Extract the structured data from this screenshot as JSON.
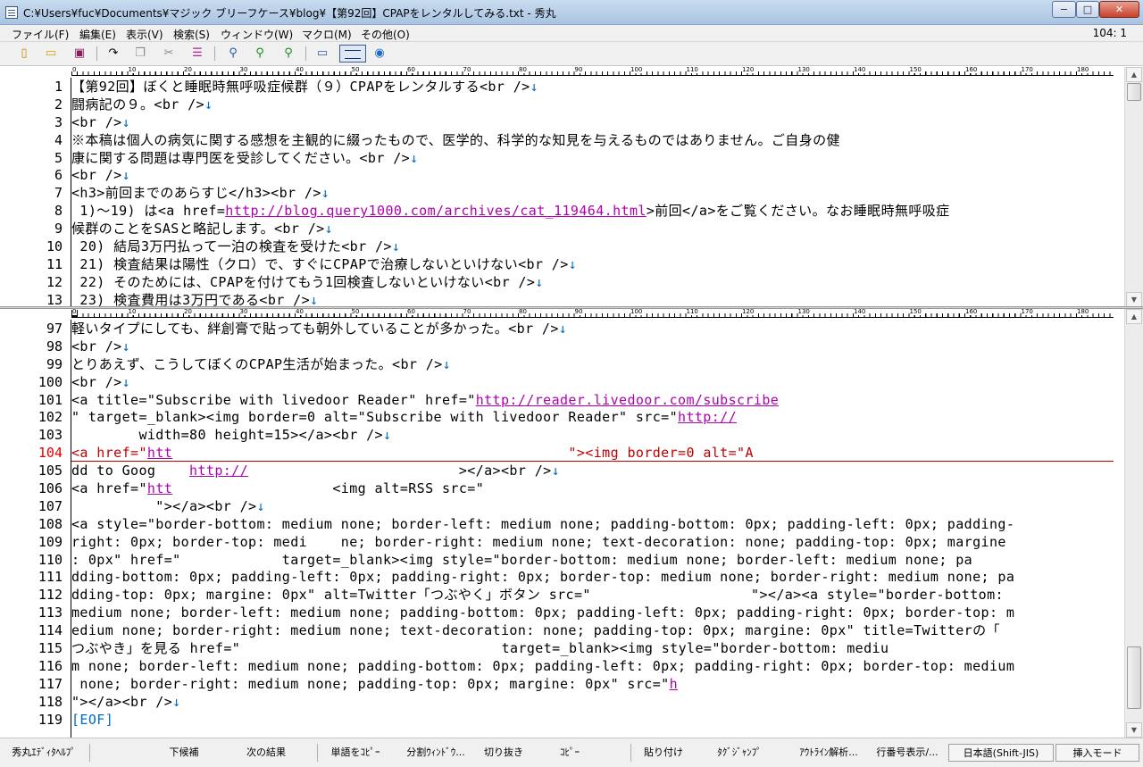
{
  "window": {
    "title": "C:¥Users¥fuc¥Documents¥マジック ブリーフケース¥blog¥【第92回】CPAPをレンタルしてみる.txt - 秀丸",
    "min": "−",
    "max": "□",
    "close": "✕"
  },
  "menu": {
    "items": [
      "ファイル(F)",
      "編集(E)",
      "表示(V)",
      "検索(S)",
      "ウィンドウ(W)",
      "マクロ(M)",
      "その他(O)"
    ],
    "cursor_position": "104: 1"
  },
  "toolbar": {
    "icons": [
      "new-file-icon",
      "open-folder-icon",
      "save-icon",
      "undo-icon",
      "copy-icon",
      "cut-icon",
      "paste-icon",
      "search-icon",
      "search-down-icon",
      "search-up-icon",
      "window-icon",
      "split-window-icon",
      "globe-icon"
    ]
  },
  "ruler": {
    "labels": [
      "0",
      "10",
      "20",
      "30",
      "40",
      "50",
      "60",
      "70",
      "80",
      "90",
      "100",
      "110",
      "120",
      "130",
      "140",
      "150",
      "160",
      "170",
      "180"
    ]
  },
  "editor_top": {
    "lines": [
      {
        "n": "1",
        "parts": [
          {
            "t": "【第92回】ぼくと睡眠時無呼吸症候群（９）CPAPをレンタルする<br />"
          }
        ]
      },
      {
        "n": "2",
        "parts": [
          {
            "t": "闘病記の９。<br />"
          }
        ]
      },
      {
        "n": "3",
        "parts": [
          {
            "t": "<br />"
          }
        ]
      },
      {
        "n": "4",
        "parts": [
          {
            "t": "※本稿は個人の病気に関する感想を主観的に綴ったもので、医学的、科学的な知見を与えるものではありません。ご自身の健"
          }
        ],
        "wrap": true
      },
      {
        "n": "5",
        "parts": [
          {
            "t": "康に関する問題は専門医を受診してください。<br />"
          }
        ]
      },
      {
        "n": "6",
        "parts": [
          {
            "t": "<br />"
          }
        ]
      },
      {
        "n": "7",
        "parts": [
          {
            "t": "<h3>前回までのあらすじ</h3><br />"
          }
        ]
      },
      {
        "n": "8",
        "parts": [
          {
            "t": " 1)〜19) は<a href="
          },
          {
            "t": "http://blog.query1000.com/archives/cat_119464.html",
            "url": true
          },
          {
            "t": ">前回</a>をご覧ください。なお睡眠時無呼吸症"
          }
        ],
        "wrap": true
      },
      {
        "n": "9",
        "parts": [
          {
            "t": "候群のことをSASと略記します。<br />"
          }
        ]
      },
      {
        "n": "10",
        "parts": [
          {
            "t": " 20) 結局3万円払って一泊の検査を受けた<br />"
          }
        ]
      },
      {
        "n": "11",
        "parts": [
          {
            "t": " 21) 検査結果は陽性（クロ）で、すぐにCPAPで治療しないといけない<br />"
          }
        ]
      },
      {
        "n": "12",
        "parts": [
          {
            "t": " 22) そのためには、CPAPを付けてもう1回検査しないといけない<br />"
          }
        ]
      },
      {
        "n": "13",
        "parts": [
          {
            "t": " 23) 検査費用は3万円である<br />"
          }
        ]
      }
    ]
  },
  "editor_bottom": {
    "current_line": "104",
    "lines": [
      {
        "n": "97",
        "parts": [
          {
            "t": "軽いタイプにしても、絆創膏で貼っても朝外していることが多かった。<br />"
          }
        ]
      },
      {
        "n": "98",
        "parts": [
          {
            "t": "<br />"
          }
        ]
      },
      {
        "n": "99",
        "parts": [
          {
            "t": "とりあえず、こうしてぼくのCPAP生活が始まった。<br />"
          }
        ]
      },
      {
        "n": "100",
        "parts": [
          {
            "t": "<br />"
          }
        ]
      },
      {
        "n": "101",
        "parts": [
          {
            "t": "<a title=\"Subscribe with livedoor Reader\" href=\""
          },
          {
            "t": "http://reader.livedoor.com/subscribe",
            "url": true
          }
        ],
        "wrap": true
      },
      {
        "n": "102",
        "parts": [
          {
            "t": "\" target=_blank><img border=0 alt=\"Subscribe with livedoor Reader\" src=\""
          },
          {
            "t": "http://",
            "url": true
          }
        ],
        "wrap": true
      },
      {
        "n": "103",
        "parts": [
          {
            "t": "        width=80 height=15></a><br />"
          }
        ]
      },
      {
        "n": "104",
        "parts": [
          {
            "t": "<a href=\""
          },
          {
            "t": "htt",
            "url": true
          },
          {
            "t": "                                               \"><img border=0 alt=\"A"
          }
        ],
        "wrap": true
      },
      {
        "n": "105",
        "parts": [
          {
            "t": "dd to Goog    "
          },
          {
            "t": "http://",
            "url": true
          },
          {
            "t": "                         ></a><br />"
          }
        ]
      },
      {
        "n": "106",
        "parts": [
          {
            "t": "<a href=\""
          },
          {
            "t": "htt",
            "url": true
          },
          {
            "t": "                   <img alt=RSS src=\""
          }
        ],
        "wrap": true
      },
      {
        "n": "107",
        "parts": [
          {
            "t": "          \"></a><br />"
          }
        ]
      },
      {
        "n": "108",
        "parts": [
          {
            "t": "<a style=\"border-bottom: medium none; border-left: medium none; padding-bottom: 0px; padding-left: 0px; padding-"
          }
        ],
        "wrap": true
      },
      {
        "n": "109",
        "parts": [
          {
            "t": "right: 0px; border-top: medi    ne; border-right: medium none; text-decoration: none; padding-top: 0px; margine"
          }
        ],
        "wrap": true
      },
      {
        "n": "110",
        "parts": [
          {
            "t": ": 0px\" href=\"            target=_blank><img style=\"border-bottom: medium none; border-left: medium none; pa"
          }
        ],
        "wrap": true
      },
      {
        "n": "111",
        "parts": [
          {
            "t": "dding-bottom: 0px; padding-left: 0px; padding-right: 0px; border-top: medium none; border-right: medium none; pa"
          }
        ],
        "wrap": true
      },
      {
        "n": "112",
        "parts": [
          {
            "t": "dding-top: 0px; margine: 0px\" alt=Twitter「つぶやく」ボタン src=\"                   \"></a><a style=\"border-bottom:"
          }
        ],
        "wrap": true
      },
      {
        "n": "113",
        "parts": [
          {
            "t": "medium none; border-left: medium none; padding-bottom: 0px; padding-left: 0px; padding-right: 0px; border-top: m"
          }
        ],
        "wrap": true
      },
      {
        "n": "114",
        "parts": [
          {
            "t": "edium none; border-right: medium none; text-decoration: none; padding-top: 0px; margine: 0px\" title=Twitterの「"
          }
        ],
        "wrap": true
      },
      {
        "n": "115",
        "parts": [
          {
            "t": "つぶやき」を見る href=\"                               target=_blank><img style=\"border-bottom: mediu"
          }
        ],
        "wrap": true
      },
      {
        "n": "116",
        "parts": [
          {
            "t": "m none; border-left: medium none; padding-bottom: 0px; padding-left: 0px; padding-right: 0px; border-top: medium"
          }
        ],
        "wrap": true
      },
      {
        "n": "117",
        "parts": [
          {
            "t": " none; border-right: medium none; padding-top: 0px; margine: 0px\" src=\""
          },
          {
            "t": "h",
            "url": true
          }
        ],
        "wrap": true
      },
      {
        "n": "118",
        "parts": [
          {
            "t": "\"></a><br />"
          }
        ]
      },
      {
        "n": "119",
        "parts": [
          {
            "t": "[EOF]",
            "eof": true
          }
        ],
        "noeol": true
      }
    ]
  },
  "statusbar": {
    "items": [
      "秀丸ｴﾃﾞｨﾀﾍﾙﾌﾟ",
      "下候補",
      "次の結果",
      "単語をｺﾋﾟｰ",
      "分割ｳｨﾝﾄﾞｳ...",
      "切り抜き",
      "ｺﾋﾟｰ",
      "貼り付け",
      "ﾀｸﾞｼﾞｬﾝﾌﾟ",
      "ｱｳﾄﾗｲﾝ解析...",
      "行番号表示/..."
    ],
    "encoding": "日本語(Shift-JIS)",
    "mode": "挿入モード"
  },
  "colors": {
    "url": "#b000b0",
    "eol": "#006cbf",
    "current_line": "#c00000"
  }
}
